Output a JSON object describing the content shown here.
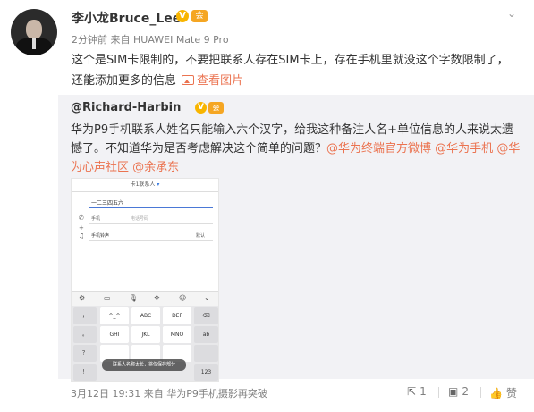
{
  "header": {
    "username": "李小龙Bruce_Lee",
    "verified_mark": "V",
    "club_mark": "会",
    "timestamp": "2分钟前",
    "source_prefix": "来自",
    "source_device": "HUAWEI Mate 9 Pro",
    "more_icon": "chevron-down-icon"
  },
  "post": {
    "text": "这个是SIM卡限制的，不要把联系人存在SIM卡上，存在手机里就没这个字数限制了，还能添加更多的信息",
    "view_image": "查看图片"
  },
  "repost": {
    "username": "@Richard-Harbin",
    "verified_mark": "V",
    "club_mark": "会",
    "text_1": "华为P9手机联系人姓名只能输入六个汉字，给我这种备注人名+单位信息的人来说太遗憾了。不知道华为是否考虑解决这个简单的问题？",
    "mentions": [
      "@华为终端官方微博",
      "@华为手机",
      "@华为心声社区",
      "@余承东"
    ]
  },
  "phone_screenshot": {
    "account": "卡1联系人",
    "name_value": "一二三四五六",
    "phone_type": "手机",
    "phone_placeholder": "电话号码",
    "ringtone_label": "手机铃声",
    "ringtone_value": "默认",
    "keys_left": [
      "，",
      "。",
      "？",
      "！"
    ],
    "keys_row1": [
      "^_^",
      "ABC",
      "DEF"
    ],
    "keys_row2": [
      "GHI",
      "JKL",
      "MNO",
      "ab"
    ],
    "keys_row4_right": "123",
    "toast": "联系人名称太长，将仅保存部分"
  },
  "footer": {
    "date": "3月12日 19:31",
    "source_prefix": "来自",
    "source": "华为P9手机摄影再突破",
    "share_count": "1",
    "comment_count": "2",
    "like_label": "赞"
  },
  "colors": {
    "link": "#eb7350",
    "repost_bg": "#f2f2f5",
    "verified": "#f8b500"
  }
}
